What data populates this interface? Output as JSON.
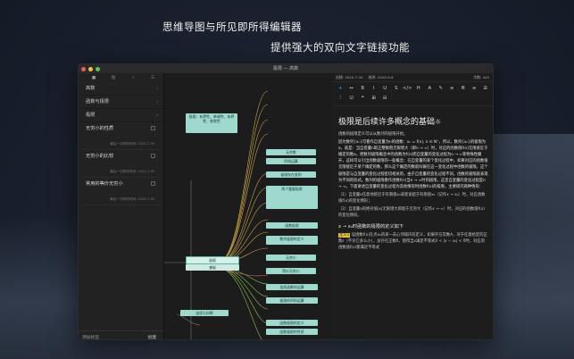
{
  "taglines": {
    "line1": "思维导图与所见即所得编辑器",
    "line2": "提供强大的双向文字链接功能"
  },
  "window": {
    "title": "极限 — 高数"
  },
  "sidebar": {
    "tabs": [
      {
        "label": "▦",
        "icon": "grid-icon"
      },
      {
        "label": "独",
        "icon": "tab-icon"
      },
      {
        "label": "☆",
        "icon": "star-icon"
      },
      {
        "label": "☰",
        "icon": "list-icon"
      }
    ],
    "sections": [
      {
        "label": "高数"
      },
      {
        "label": "函数与极限"
      },
      {
        "label": "极限"
      }
    ],
    "notes": [
      {
        "title": "无穷小的性质",
        "date": "最后一次修改时间: 2020-7-30"
      },
      {
        "title": "无穷小的比较",
        "date": "最后一次修改时间: 2020-7-30"
      },
      {
        "title": "常用的等价无穷小",
        "date": "最后一次修改时间: 2020-7-30"
      }
    ],
    "bottom": {
      "new_tag": "添加标签",
      "create": "创建"
    }
  },
  "mindmap": {
    "nodes": {
      "root": "极限",
      "root_sub": "基础",
      "left_top": "极限：有界性、单调性、有界性、收敛性",
      "left_bottom": "连续与间断",
      "r1": "无穷数",
      "r2": "四则运算",
      "r3": "极限存在准则",
      "r4": "两个重要极限",
      "r5": "函数极限",
      "r6": "数列极限的定义",
      "r7": "无穷小",
      "r8": "等价无穷小",
      "r9": "连续函数的运算",
      "r10": "极限的四则运算",
      "r11": "初等函数的连续性",
      "r12": "函数极限的定义",
      "r13": "函数极限的性质",
      "r14": "函数的极限",
      "r15": "数列极限",
      "r16": "极限存在准则"
    }
  },
  "editor": {
    "status": {
      "created": "创建: 2020-7-30",
      "modified": "修改: 2020-9-6",
      "count": "字数: 445"
    },
    "toolbar": [
      "+",
      "↔",
      "B",
      "I",
      "U",
      "S",
      "</>",
      "H",
      "A",
      "✎",
      "≡",
      "≣",
      "≡",
      "☰",
      "⁝",
      "☑",
      "❝",
      "⊞",
      "⊟"
    ],
    "heading": "极限是后续许多概念的基础",
    "heading_emoji": "☼",
    "paragraphs": [
      "函数的极限定义可以从数列的极限开始。",
      "因为数列{xₙ}可看作自变量为n的函数：xₙ = f(n), n ∈ N⁺，所以，数列{xₙ}的极限为a，就是：当自变量n取正整数而无限增大（即n → ∞）时，对应的函数值f(n)无限接近于确定的数a。把数列极限概念中的函数为f(n)而自变量的变化过程为n → ∞等特殊性撇开，这样可以引出函数极限的一般概念：在自变量的某个变化过程中，如果对应的函数值无限接近于某个确定的数，那么这个确定的数就叫做在这一变化过程中函数的极限。这个极限是与自变量的变化过程密切相关的，由于自变量的变化过程不同，函数的极限就表现为不同的形式。数列的极限看作函数f(n)当n → ∞时的极限，这里自变量的变化过程是n → ∞。下面讲述自变量的变化过程为其他情形时函数f(x)的极限，主要研究两种情形：",
      "（1）自变量x任意地接近于有限值x₀或者说趋于有限值x₀（记作x → x₀）时，对应函数值f(x)的变化情形；",
      "（2）自变量x的绝对值|x|无限增大即趋于无穷大（记作x → ∞）时，对应的函数值f(x)的变化情形。"
    ],
    "subheading": "x → x₀时函数的极限的定义如下",
    "def_label": "定义1",
    "def_text": "设函数f(x)在点x₀的某一去心邻域内有定义，如果存在常数A，对于任意给定的正数ε（不论它多么小），总存在正数δ，使得当x满足不等式0 < |x − x₀| < δ时，对应的函数值f(x)都满足不等式"
  }
}
